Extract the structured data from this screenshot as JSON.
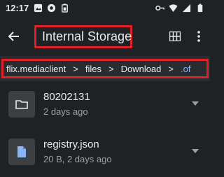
{
  "status_bar": {
    "time": "12:17",
    "left_icons": [
      "image-notification-icon",
      "camera-notification-icon",
      "battery-saver-icon"
    ],
    "right_icons": [
      "vpn-key-icon",
      "wifi-icon",
      "signal-icon",
      "battery-icon"
    ]
  },
  "toolbar": {
    "title": "Internal Storage",
    "back_icon": "arrow-back-icon",
    "grid_icon": "grid-view-icon",
    "more_icon": "more-vert-icon"
  },
  "breadcrumb": {
    "items": [
      "flix.mediaclient",
      "files",
      "Download",
      ".of"
    ],
    "separator": ">"
  },
  "files": [
    {
      "name": "80202131",
      "meta": "2 days ago",
      "icon": "folder-icon"
    },
    {
      "name": "registry.json",
      "meta": "20 B, 2 days ago",
      "icon": "document-icon"
    }
  ],
  "colors": {
    "background": "#202124",
    "breadcrumb_bar": "#2a2b2e",
    "highlight_box": "#e01f26",
    "active_crumb": "#8ab4f8",
    "thumb_bg": "#3c4043"
  }
}
